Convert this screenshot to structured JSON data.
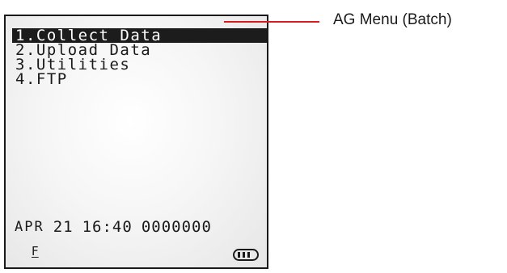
{
  "menu": {
    "items": [
      {
        "label": "1.Collect Data",
        "selected": true
      },
      {
        "label": "2.Upload Data",
        "selected": false
      },
      {
        "label": "3.Utilities",
        "selected": false
      },
      {
        "label": "4.FTP",
        "selected": false
      }
    ]
  },
  "status": {
    "month": "APR",
    "day": "21",
    "time": "16:40",
    "counter": "0000000"
  },
  "indicators": {
    "function_key": "F",
    "battery_icon": "battery-full-icon",
    "battery_level": 1.0
  },
  "annotation": {
    "label": "AG Menu (Batch)",
    "color": "#d81c1c"
  },
  "colors": {
    "selection_bg": "#1c1c1c",
    "selection_fg": "#ffffff",
    "text": "#1a1a1a"
  }
}
